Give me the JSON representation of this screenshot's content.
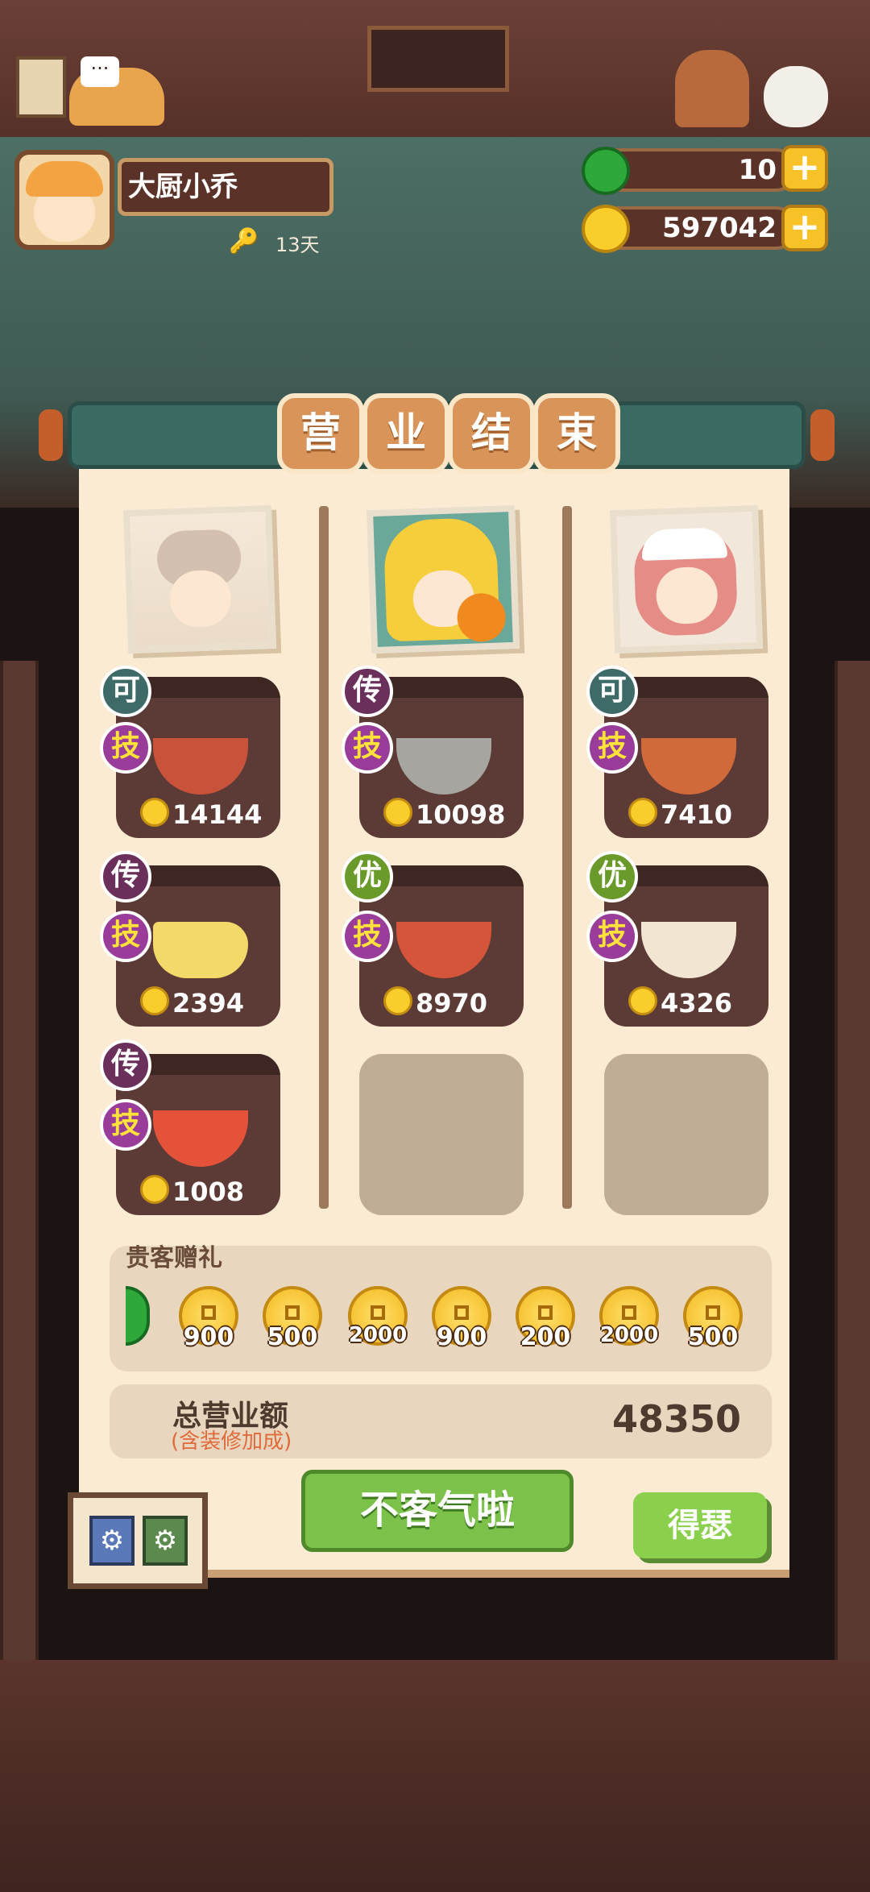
{
  "player": {
    "name": "大厨小乔",
    "days": "13天"
  },
  "resources": {
    "jade": "10",
    "coins": "597042"
  },
  "banner": {
    "chars": [
      "营",
      "业",
      "结",
      "束"
    ]
  },
  "columns": [
    {
      "dishes": [
        {
          "rank": "可",
          "skill": "技",
          "value": "14144"
        },
        {
          "rank": "传",
          "skill": "技",
          "value": "2394"
        },
        {
          "rank": "传",
          "skill": "技",
          "value": "1008"
        }
      ]
    },
    {
      "dishes": [
        {
          "rank": "传",
          "skill": "技",
          "value": "10098"
        },
        {
          "rank": "优",
          "skill": "技",
          "value": "8970"
        }
      ]
    },
    {
      "dishes": [
        {
          "rank": "可",
          "skill": "技",
          "value": "7410"
        },
        {
          "rank": "优",
          "skill": "技",
          "value": "4326"
        }
      ]
    }
  ],
  "gifts": {
    "title": "贵客赠礼",
    "items": [
      "900",
      "500",
      "2000",
      "900",
      "200",
      "2000",
      "500"
    ]
  },
  "total": {
    "label": "总营业额",
    "sublabel": "(含装修加成)",
    "value": "48350"
  },
  "buttons": {
    "main": "不客气啦",
    "side": "得瑟"
  },
  "colors": {
    "rank_ke": "#3e6b67",
    "rank_chuan": "#6a2f5a",
    "rank_you": "#6a9a2a",
    "skill": "#9a3c9a",
    "accent_green": "#7cc24a",
    "coin": "#f8cd2c"
  }
}
